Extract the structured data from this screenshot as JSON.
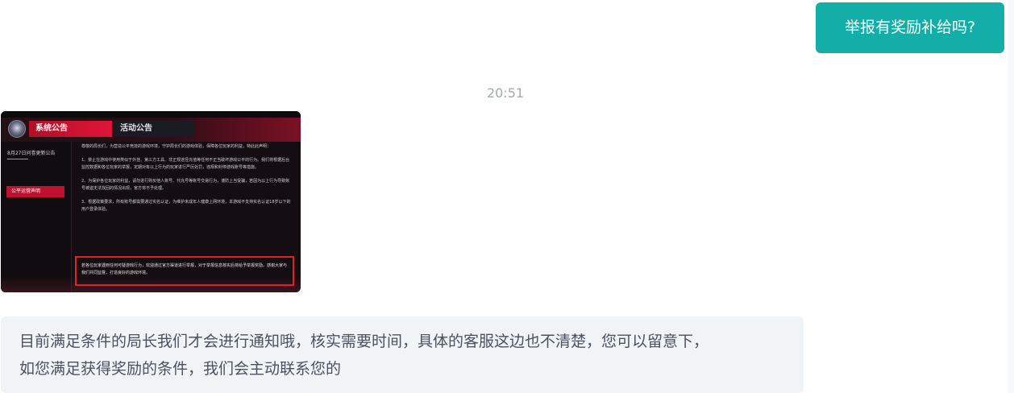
{
  "messages": {
    "user_question": "举报有奖励补给吗?",
    "timestamp": "20:51",
    "agent_reply": "目前满足条件的局长我们才会进行通知哦，核实需要时间，具体的客服这边也不清楚，您可以留意下，\n如您满足获得奖励的条件，我们会主动联系您的"
  },
  "screenshot": {
    "tabs": {
      "system": "系统公告",
      "activity": "活动公告"
    },
    "sidebar": {
      "update_notice": "8月27日问卷更新公告",
      "fairness_statement": "公平运营声明"
    },
    "content": {
      "intro": "尊敬的局长们，为营造公平竞技的游戏环境，守护局长们的游戏体验，保障各位玩家的利益，特此此声明：",
      "item1": "1、禁止在游戏中使用类似于外挂、第三方工具、非正规途径充值等任何不正当破坏游戏公平的行为。我们将根据后台监控数据和各位玩家的举报，定期对有以上行为的玩家进行严厉处罚，违规和封停游戏账号等措施。",
      "item2": "2、为保护各位玩家的利益，请勿进行购买他人账号、代充号等账号交易行为，谨防上当受骗，若因为以上行为导致账号被盗无法找回的情况出现，官方将不予处理。",
      "item3": "3、根据政策要求，所有账号都需要通过实名认证，为维护未成年人健康上网环境，本游戏不支持实名认证18岁以下的用户登录体验。",
      "highlight": "若各位玩家遇到任何可疑游戏行为，欢迎通过官方渠道进行举报，对于举报信息核实后将给予举报奖励。感谢大家与我们共同监督，打造良好的游戏环境。"
    }
  },
  "colors": {
    "user_bubble": "#14aea8",
    "agent_bubble": "#f1f4f7",
    "timestamp": "#a3a8b0",
    "highlight_border": "#e0202a"
  }
}
